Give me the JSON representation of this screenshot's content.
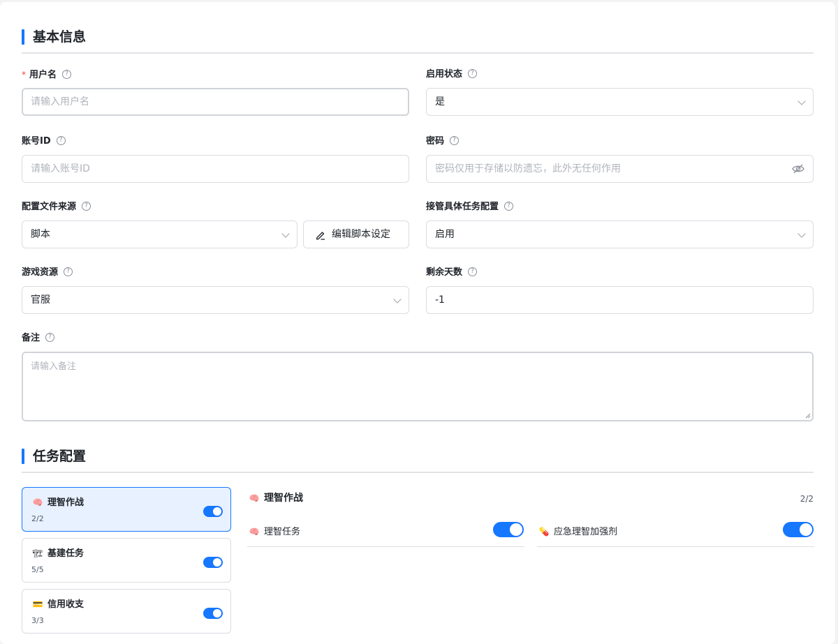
{
  "basic_info": {
    "section_title": "基本信息",
    "username": {
      "label": "用户名",
      "required_mark": "*",
      "placeholder": "请输入用户名",
      "value": ""
    },
    "enabled_status": {
      "label": "启用状态",
      "value": "是"
    },
    "account_id": {
      "label": "账号ID",
      "placeholder": "请输入账号ID",
      "value": ""
    },
    "password": {
      "label": "密码",
      "placeholder": "密码仅用于存储以防遗忘，此外无任何作用",
      "value": ""
    },
    "config_source": {
      "label": "配置文件来源",
      "value": "脚本",
      "edit_button_label": "编辑脚本设定"
    },
    "takeover_config": {
      "label": "接管具体任务配置",
      "value": "启用"
    },
    "game_resource": {
      "label": "游戏资源",
      "value": "官服"
    },
    "remaining_days": {
      "label": "剩余天数",
      "value": "-1"
    },
    "remarks": {
      "label": "备注",
      "placeholder": "请输入备注",
      "value": ""
    },
    "help_glyph": "?"
  },
  "task_config": {
    "section_title": "任务配置",
    "tasks": [
      {
        "name": "理智作战",
        "count": "2/2",
        "enabled": true,
        "icon": "brain-icon",
        "emoji": "🧠",
        "active": true
      },
      {
        "name": "基建任务",
        "count": "5/5",
        "enabled": true,
        "icon": "building-icon",
        "emoji": "🏗",
        "active": false
      },
      {
        "name": "信用收支",
        "count": "3/3",
        "enabled": true,
        "icon": "credit-card-icon",
        "emoji": "💳",
        "active": false
      }
    ],
    "detail": {
      "title": "理智作战",
      "icon": "brain-icon",
      "emoji": "🧠",
      "count": "2/2",
      "items": [
        {
          "name": "理智任务",
          "icon": "brain-icon",
          "emoji": "🧠",
          "enabled": true
        },
        {
          "name": "应急理智加强剂",
          "icon": "pill-icon",
          "emoji": "💊",
          "enabled": true
        }
      ]
    }
  },
  "colors": {
    "accent": "#1677ff",
    "required": "#f53f3f",
    "active_card_bg": "#e8f1ff"
  }
}
